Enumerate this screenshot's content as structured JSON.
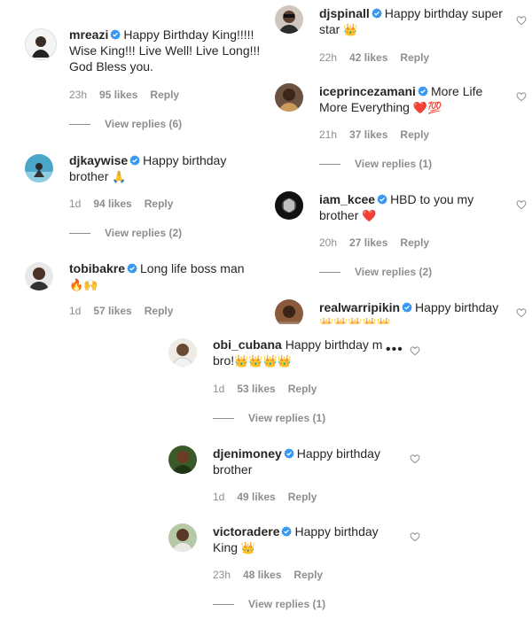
{
  "comments": {
    "mreazi": {
      "user": "mreazi",
      "text": "Happy Birthday King!!!!! Wise King!!! Live Well! Live Long!!! God Bless you.",
      "time": "23h",
      "likes": "95 likes",
      "reply": "Reply",
      "replies": "View replies (6)"
    },
    "djkaywise": {
      "user": "djkaywise",
      "text": "Happy birthday brother",
      "emoji": "🙏",
      "time": "1d",
      "likes": "94 likes",
      "reply": "Reply",
      "replies": "View replies (2)"
    },
    "tobibakre": {
      "user": "tobibakre",
      "text": "Long life boss man",
      "emoji": "🔥🙌",
      "time": "1d",
      "likes": "57 likes",
      "reply": "Reply"
    },
    "djspinall": {
      "user": "djspinall",
      "text": "Happy birthday super star",
      "emoji": "👑",
      "time": "22h",
      "likes": "42 likes",
      "reply": "Reply"
    },
    "iceprincezamani": {
      "user": "iceprincezamani",
      "text": "More Life More Everything",
      "emoji": "❤️💯",
      "time": "21h",
      "likes": "37 likes",
      "reply": "Reply",
      "replies": "View replies (1)"
    },
    "iam_kcee": {
      "user": "iam_kcee",
      "text": "HBD to you my brother",
      "emoji": "❤️",
      "time": "20h",
      "likes": "27 likes",
      "reply": "Reply",
      "replies": "View replies (2)"
    },
    "realwarripikin": {
      "user": "realwarripikin",
      "text": "Happy birthday",
      "emoji": "👑👑👑👑👑"
    },
    "obi_cubana": {
      "user": "obi_cubana",
      "text": "Happy birthday m bro!",
      "emoji": "👑👑👑👑",
      "time": "1d",
      "likes": "53 likes",
      "reply": "Reply",
      "replies": "View replies (1)"
    },
    "djenimoney": {
      "user": "djenimoney",
      "text": "Happy birthday brother",
      "time": "1d",
      "likes": "49 likes",
      "reply": "Reply"
    },
    "victoradere": {
      "user": "victoradere",
      "text": "Happy birthday King",
      "emoji": "👑",
      "time": "23h",
      "likes": "48 likes",
      "reply": "Reply",
      "replies": "View replies (1)"
    }
  },
  "icons": {
    "verified": "verified-badge-icon",
    "heart": "heart-outline-icon",
    "more": "more-options-icon"
  },
  "colors": {
    "verified": "#3897f0",
    "meta": "#8e8e8e",
    "text": "#262626"
  }
}
